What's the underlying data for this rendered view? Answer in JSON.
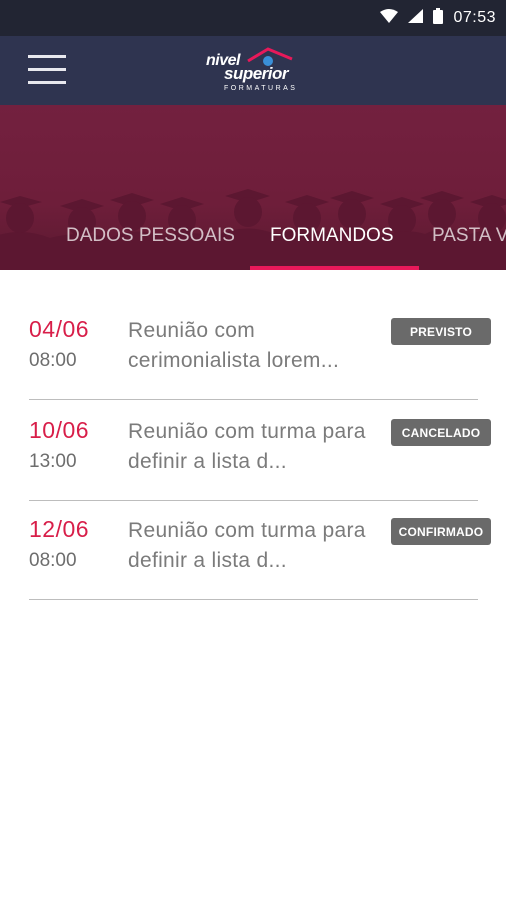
{
  "status_bar": {
    "time": "07:53",
    "icons": [
      "wifi-icon",
      "signal-icon",
      "battery-icon"
    ]
  },
  "app_bar": {
    "menu_icon": "hamburger-menu-icon",
    "logo": {
      "line1": "nivel",
      "line2": "superior",
      "line3": "FORMATURAS"
    }
  },
  "tabs": [
    {
      "label": "DADOS PESSOAIS",
      "active": false
    },
    {
      "label": "FORMANDOS",
      "active": true
    },
    {
      "label": "PASTA V",
      "active": false
    }
  ],
  "events": [
    {
      "date": "04/06",
      "time": "08:00",
      "title": "Reunião com cerimonialista lorem...",
      "status": "PREVISTO"
    },
    {
      "date": "10/06",
      "time": "13:00",
      "title": "Reunião com turma para definir a lista d...",
      "status": "CANCELADO"
    },
    {
      "date": "12/06",
      "time": "08:00",
      "title": "Reunião com turma para definir a lista d...",
      "status": "CONFIRMADO"
    }
  ],
  "colors": {
    "status_bar": "#222533",
    "app_bar": "#2f3450",
    "hero": "#73203f",
    "accent": "#e8195a",
    "date_text": "#d81e49",
    "badge": "#6a6a6a"
  }
}
